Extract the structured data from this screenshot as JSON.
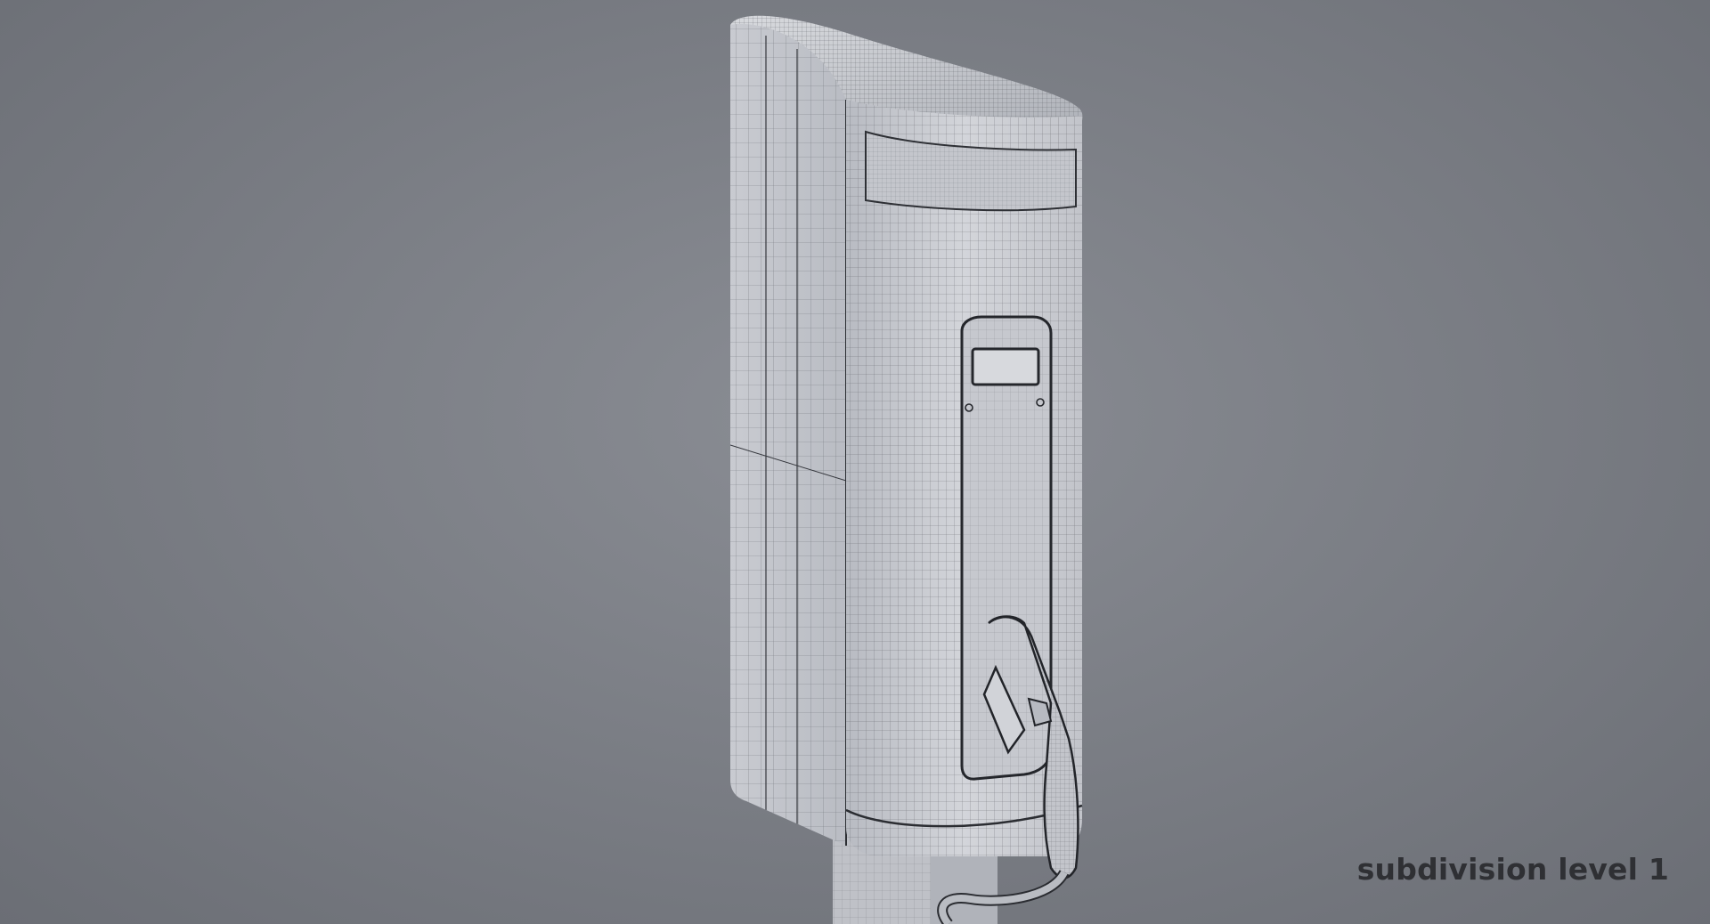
{
  "caption": {
    "text": "subdivision level 1"
  },
  "scene": {
    "subject": "ev-charger-wireframe",
    "background_color": "#7c7f86",
    "surface_color": "#c9cbd0",
    "wire_color": "#3a3c42"
  }
}
